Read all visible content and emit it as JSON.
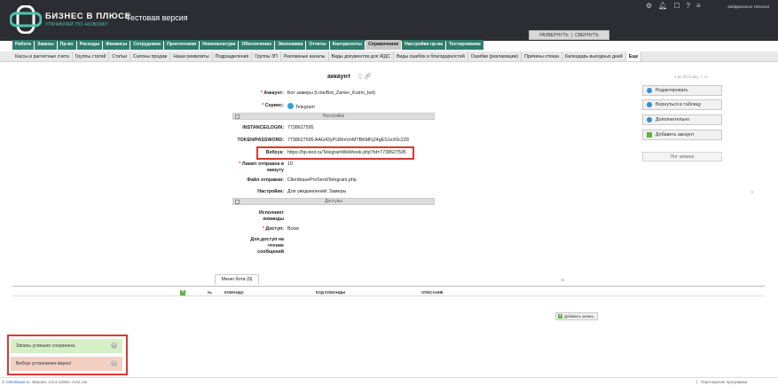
{
  "header": {
    "brand_name": "БИЗНЕС В ПЛЮСЕ",
    "brand_tagline": "УПРАВЛЯЙ ПО-НОВОМУ",
    "version_label": "Тестовая версия",
    "user_name": "Зайфриозное Наталья",
    "icons": [
      "gear-icon",
      "bell-icon",
      "bookmark-icon",
      "help-icon",
      "list-icon",
      "logout-icon"
    ],
    "expand_label": "РАЗВЕРНУТЬ",
    "collapse_label": "СВЕРНУТЬ",
    "separator": "|"
  },
  "nav": {
    "tabs": [
      "Работа",
      "Заказы",
      "Пр-во",
      "Расходы",
      "Финансы",
      "Сотрудники",
      "Просчетники",
      "Номенклатура",
      "Обеспечение",
      "Экономика",
      "Отчеты",
      "Контрагенты",
      "Справочники",
      "Настройки пр-ва",
      "Тестирование"
    ],
    "active_tab": "Справочники"
  },
  "subnav": {
    "items": [
      "Кассы и расчетные счета",
      "Группы статей",
      "Статьи",
      "Сапоны продаж",
      "Наши реквизиты",
      "Подразделения",
      "Группы ЗП",
      "Рекламные каналы",
      "Виды документов для ЖДС",
      "Виды ошибок и благодарностей",
      "Ошибки (рекламации)",
      "Причины отказа",
      "Календарь выходных дней",
      "Еще"
    ],
    "active_item": "Еще"
  },
  "record": {
    "title": "аккаунт",
    "pager": "1 из 10  След. >  >>",
    "fields": {
      "account": {
        "label": "Аккаунт:",
        "value": "Бот замеры (t.me/Bot_Zamer_Kutrin_bot)"
      },
      "service": {
        "label": "Сервис:",
        "value": "Telegram"
      },
      "settings_section": "Настройки",
      "instance": {
        "label": "INSTANCE/LOGIN:",
        "value": "7738627595"
      },
      "token": {
        "label": "TOKEN/PASSWORD:",
        "value": "7738627595:AAG43yPIJRmVnMTBKMFjZ4gES1eX0c2Z8"
      },
      "webhook": {
        "label": "Вебхук:",
        "value": "https://bp-test.ru/TelegramWebhook.php?id=7738627595"
      },
      "send_limit": {
        "label": "Лимит отправок в минуту",
        "value": "10"
      },
      "send_file": {
        "label": "Файл отправки:",
        "value": "ClientbaseProSendTelegram.php"
      },
      "settings": {
        "label": "Настройки:",
        "value": "Для уведомлений: Замеры"
      },
      "access_section": "Доступы",
      "executes_commands": {
        "label": "Исполняет команды",
        "value": ""
      },
      "access": {
        "label": "Доступ:",
        "value": "Всем"
      },
      "extra_access": {
        "label": "Доп.доступ на чтение сообщений",
        "value": ""
      }
    }
  },
  "actions": {
    "edit": "Редактировать",
    "back": "Вернуться в таблицу",
    "more": "Дополнительно",
    "add_account": "Добавить аккаунт",
    "log": "Лог записи"
  },
  "bots_menu": {
    "tab_label": "Меню бота (0)",
    "columns": [
      "№",
      "КОМАНДА",
      "КОД КОМАНДЫ",
      "ОПИСАНИЕ"
    ],
    "add_command": "Добавить запись"
  },
  "notifications": {
    "saved": "Запись успешно сохранена.",
    "webhook_set": "Вебхук установлен верно!"
  },
  "footer": {
    "site": "Clientbase.ru",
    "version": "Версия: 3.0.4.22561: 0.42 сек",
    "partner": "Партнерская программа"
  },
  "colors": {
    "header_bg": "#2b2d33",
    "tab_bg": "#2f7d6b",
    "accent_red": "#d83a34",
    "success_bg": "#d7efc6",
    "warning_bg": "#f3d0c4"
  }
}
